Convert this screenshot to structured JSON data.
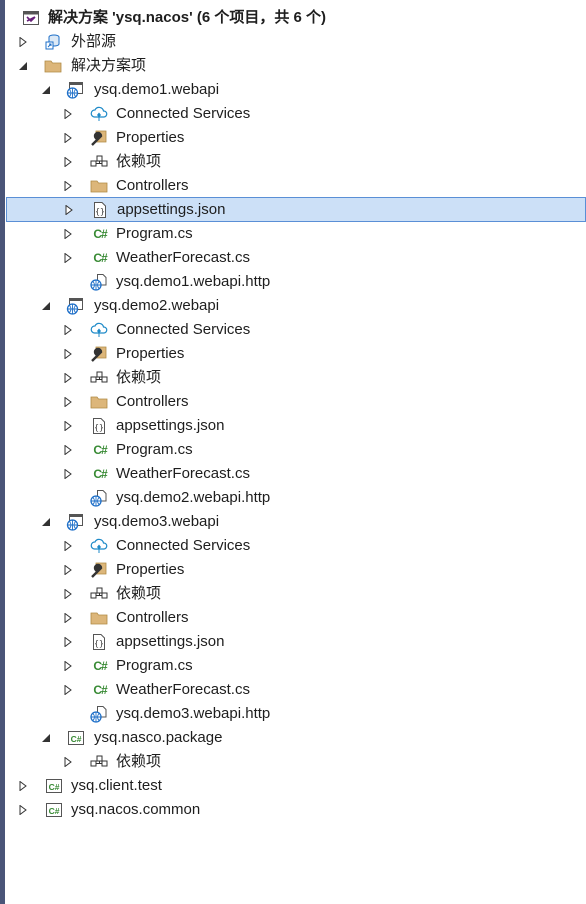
{
  "solution": {
    "title": "解决方案 'ysq.nacos' (6 个项目，共 6 个)",
    "external_sources": "外部源",
    "solution_items": "解决方案项",
    "projects": [
      {
        "name": "ysq.demo1.webapi",
        "items": {
          "connected_services": "Connected Services",
          "properties": "Properties",
          "dependencies": "依赖项",
          "controllers": "Controllers",
          "appsettings": "appsettings.json",
          "program": "Program.cs",
          "weather": "WeatherForecast.cs",
          "http": "ysq.demo1.webapi.http"
        }
      },
      {
        "name": "ysq.demo2.webapi",
        "items": {
          "connected_services": "Connected Services",
          "properties": "Properties",
          "dependencies": "依赖项",
          "controllers": "Controllers",
          "appsettings": "appsettings.json",
          "program": "Program.cs",
          "weather": "WeatherForecast.cs",
          "http": "ysq.demo2.webapi.http"
        }
      },
      {
        "name": "ysq.demo3.webapi",
        "items": {
          "connected_services": "Connected Services",
          "properties": "Properties",
          "dependencies": "依赖项",
          "controllers": "Controllers",
          "appsettings": "appsettings.json",
          "program": "Program.cs",
          "weather": "WeatherForecast.cs",
          "http": "ysq.demo3.webapi.http"
        }
      },
      {
        "name": "ysq.nasco.package",
        "items": {
          "dependencies": "依赖项"
        }
      },
      {
        "name": "ysq.client.test"
      },
      {
        "name": "ysq.nacos.common"
      }
    ],
    "csharp_glyph": "C#"
  },
  "colors": {
    "selection_bg": "#cce0f7",
    "selection_border": "#5a8fd6",
    "folder": "#dcb67a",
    "csharp": "#388a34",
    "web_globe": "#1e6fc8"
  }
}
